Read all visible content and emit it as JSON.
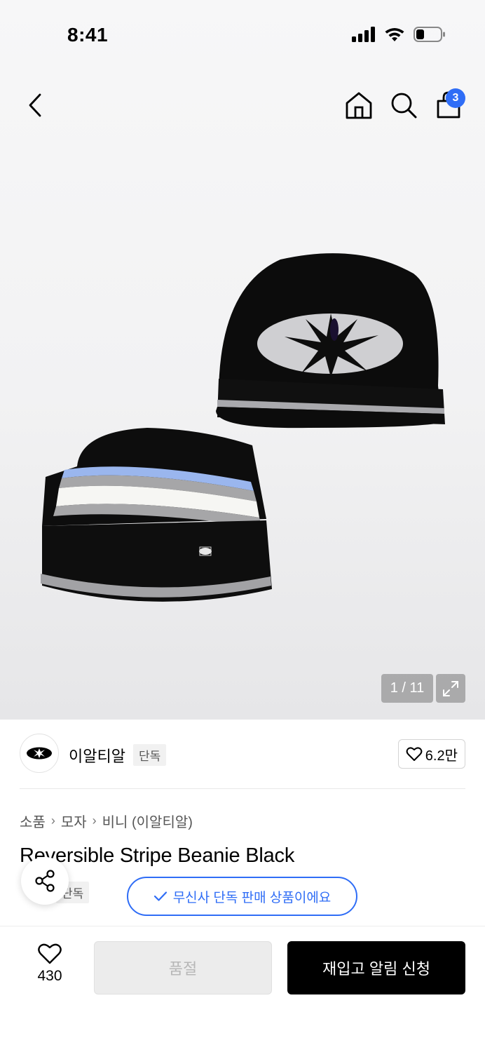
{
  "status_bar": {
    "time": "8:41"
  },
  "header": {
    "cart_count": "3"
  },
  "gallery": {
    "counter": "1 / 11"
  },
  "brand": {
    "name": "이알티알",
    "tag": "단독",
    "likes": "6.2만"
  },
  "breadcrumb": [
    "소품",
    "모자",
    "비니 (이알티알)"
  ],
  "product": {
    "title": "Reversible Stripe Beanie Black",
    "exclusive_tag": "단독",
    "exclusive_notice": "무신사 단독 판매 상품이에요"
  },
  "bottom_bar": {
    "like_count": "430",
    "soldout_label": "품절",
    "restock_label": "재입고 알림 신청"
  },
  "colors": {
    "accent": "#2f6df6",
    "primary_button": "#000000"
  }
}
